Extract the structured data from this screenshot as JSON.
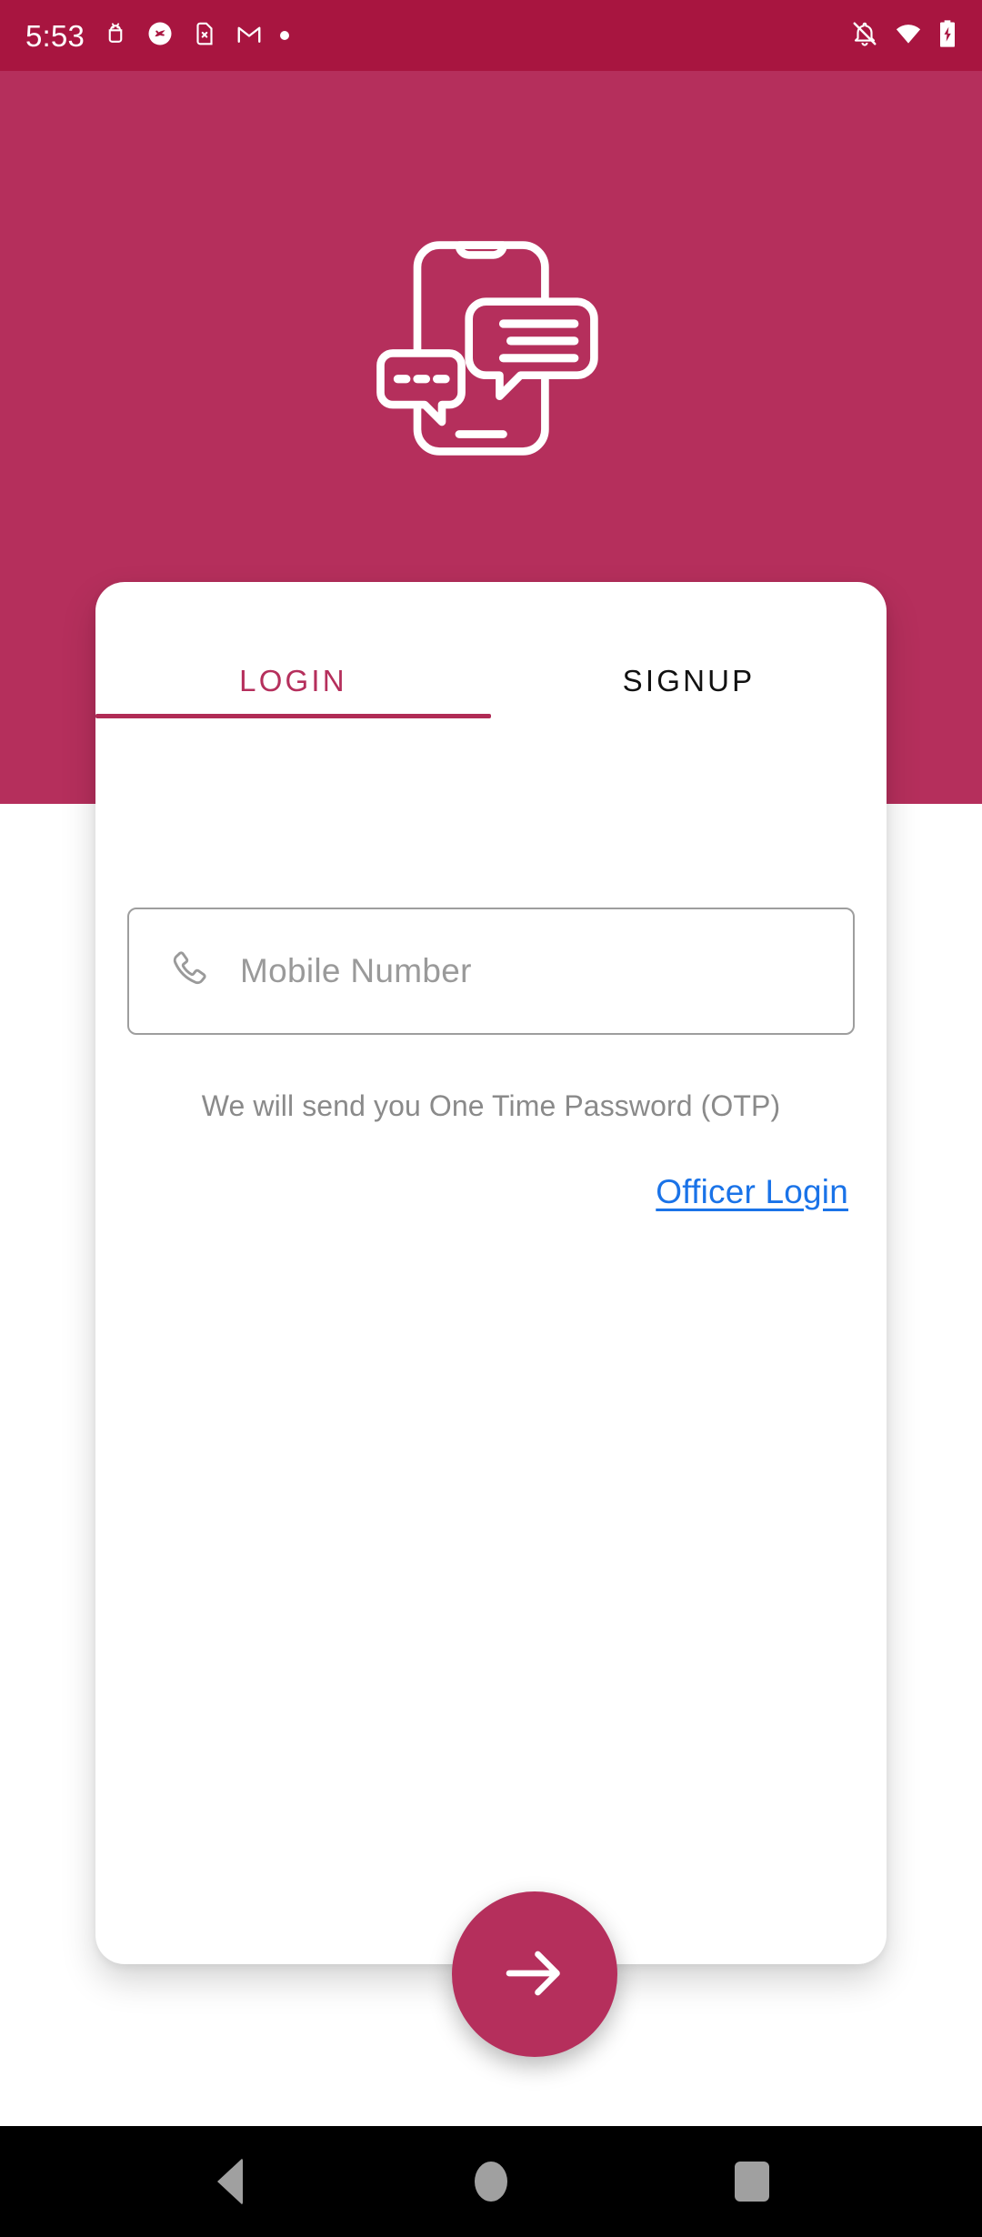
{
  "status_bar": {
    "time": "5:53",
    "background": "#A81540",
    "left_icons": [
      {
        "name": "android-debug-icon"
      },
      {
        "name": "app-notification-icon"
      },
      {
        "name": "sim-card-missing-icon"
      },
      {
        "name": "gmail-icon"
      },
      {
        "name": "more-notifications-dot-icon"
      }
    ],
    "right_icons": [
      {
        "name": "notifications-off-icon"
      },
      {
        "name": "wifi-icon"
      },
      {
        "name": "battery-charging-icon"
      }
    ]
  },
  "hero": {
    "background": "#B52F5C",
    "illustration": "phone-chat-bubbles-illustration"
  },
  "card": {
    "tabs": [
      {
        "label": "LOGIN",
        "active": true,
        "name": "tab-login"
      },
      {
        "label": "SIGNUP",
        "active": false,
        "name": "tab-signup"
      }
    ],
    "accent_color": "#B52F5C",
    "mobile_field": {
      "value": "",
      "placeholder": "Mobile Number",
      "icon": "phone-icon"
    },
    "helper_text": "We will send you One Time Password (OTP)",
    "officer_login_label": "Officer Login",
    "officer_login_color": "#1a73e8",
    "submit_button": {
      "icon": "arrow-right-icon",
      "background": "#B52F5C"
    }
  },
  "nav_bar": {
    "background": "#000000",
    "buttons": [
      {
        "name": "nav-back-button",
        "icon": "triangle-back-icon"
      },
      {
        "name": "nav-home-button",
        "icon": "circle-home-icon"
      },
      {
        "name": "nav-recents-button",
        "icon": "square-recents-icon"
      }
    ]
  }
}
